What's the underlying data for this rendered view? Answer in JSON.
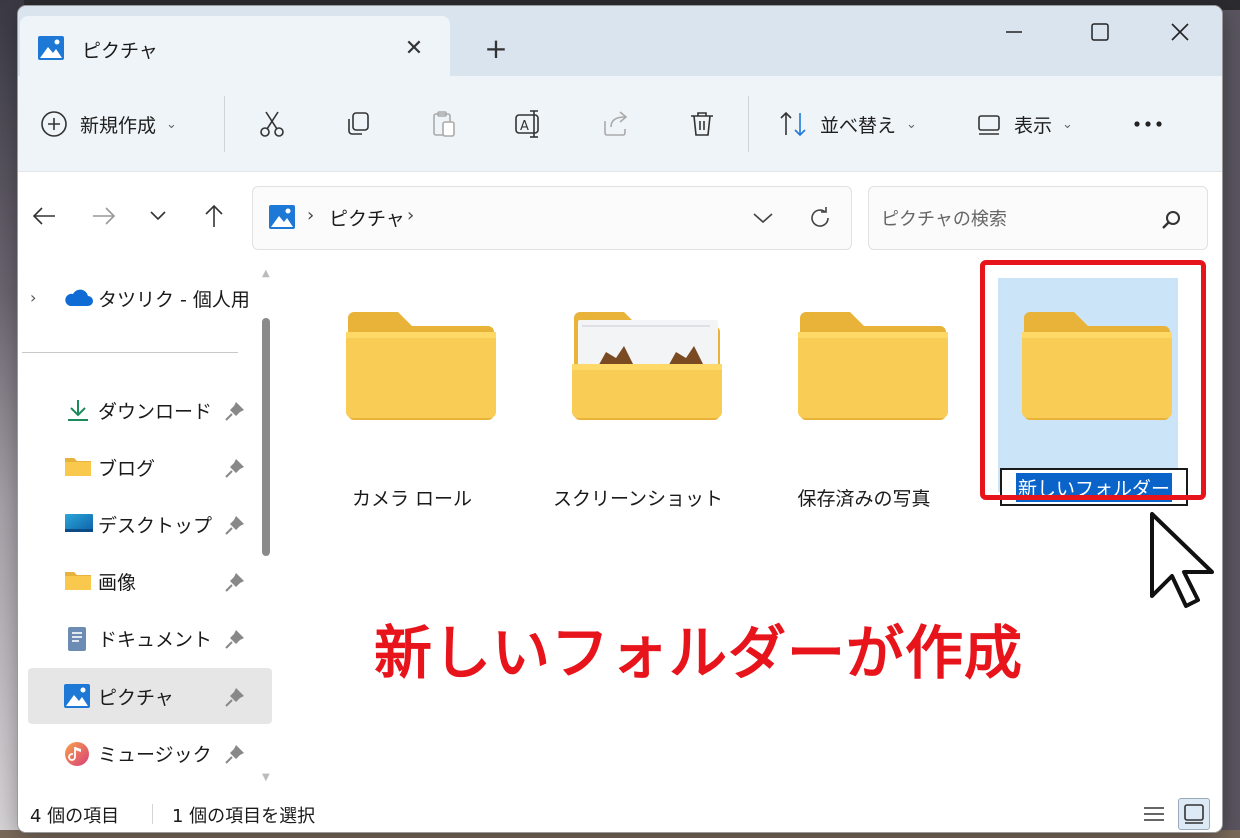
{
  "window": {
    "tab_title": "ピクチャ",
    "tab_icon": "pictures-icon",
    "controls": [
      "minimize-icon",
      "maximize-icon",
      "close-icon"
    ]
  },
  "toolbar": {
    "new_label": "新規作成",
    "sort_label": "並べ替え",
    "view_label": "表示",
    "icons": [
      "cut-icon",
      "copy-icon",
      "paste-icon",
      "rename-icon",
      "share-icon",
      "delete-icon",
      "more-icon"
    ]
  },
  "address": {
    "crumb": "ピクチャ",
    "search_placeholder": "ピクチャの検索"
  },
  "nav": {
    "cloud_label": "タツリク - 個人用",
    "items": [
      {
        "label": "ダウンロード",
        "icon": "download-icon"
      },
      {
        "label": "ブログ",
        "icon": "folder-icon"
      },
      {
        "label": "デスクトップ",
        "icon": "desktop-icon"
      },
      {
        "label": "画像",
        "icon": "folder-icon"
      },
      {
        "label": "ドキュメント",
        "icon": "documents-icon"
      },
      {
        "label": "ピクチャ",
        "icon": "pictures-icon"
      },
      {
        "label": "ミュージック",
        "icon": "music-icon"
      }
    ]
  },
  "folders": [
    {
      "label": "カメラ ロール"
    },
    {
      "label": "スクリーンショット"
    },
    {
      "label": "保存済みの写真"
    },
    {
      "label": "新しいフォルダー"
    }
  ],
  "annotation": {
    "text": "新しいフォルダーが作成",
    "color": "#e8141b"
  },
  "status": {
    "count": "4 個の項目",
    "selected": "1 個の項目を選択"
  },
  "colors": {
    "accent": "#0a63c9",
    "selection": "#cce4f7",
    "folder": "#f8c94c"
  }
}
